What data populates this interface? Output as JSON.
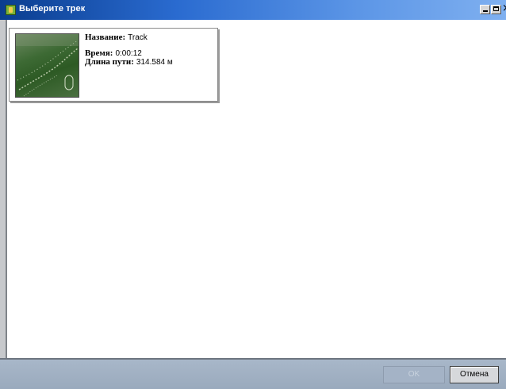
{
  "window": {
    "title": "Выберите трек"
  },
  "track_card": {
    "name_label": "Название:",
    "name_value": "Track",
    "time_label": "Время:",
    "time_value": "0:00:12",
    "length_label": "Длина пути:",
    "length_value": "314.584 м"
  },
  "buttons": {
    "ok": "OK",
    "cancel": "Отмена"
  },
  "colors": {
    "titlebar_start": "#0a3d8f",
    "titlebar_end": "#7fb0f0",
    "bottom_bar": "#a8b7c9",
    "thumbnail_green": "#3d6a34"
  },
  "icons": {
    "app": "app-icon",
    "minimize": "minimize-icon",
    "maximize": "maximize-icon",
    "close": "close-icon"
  }
}
